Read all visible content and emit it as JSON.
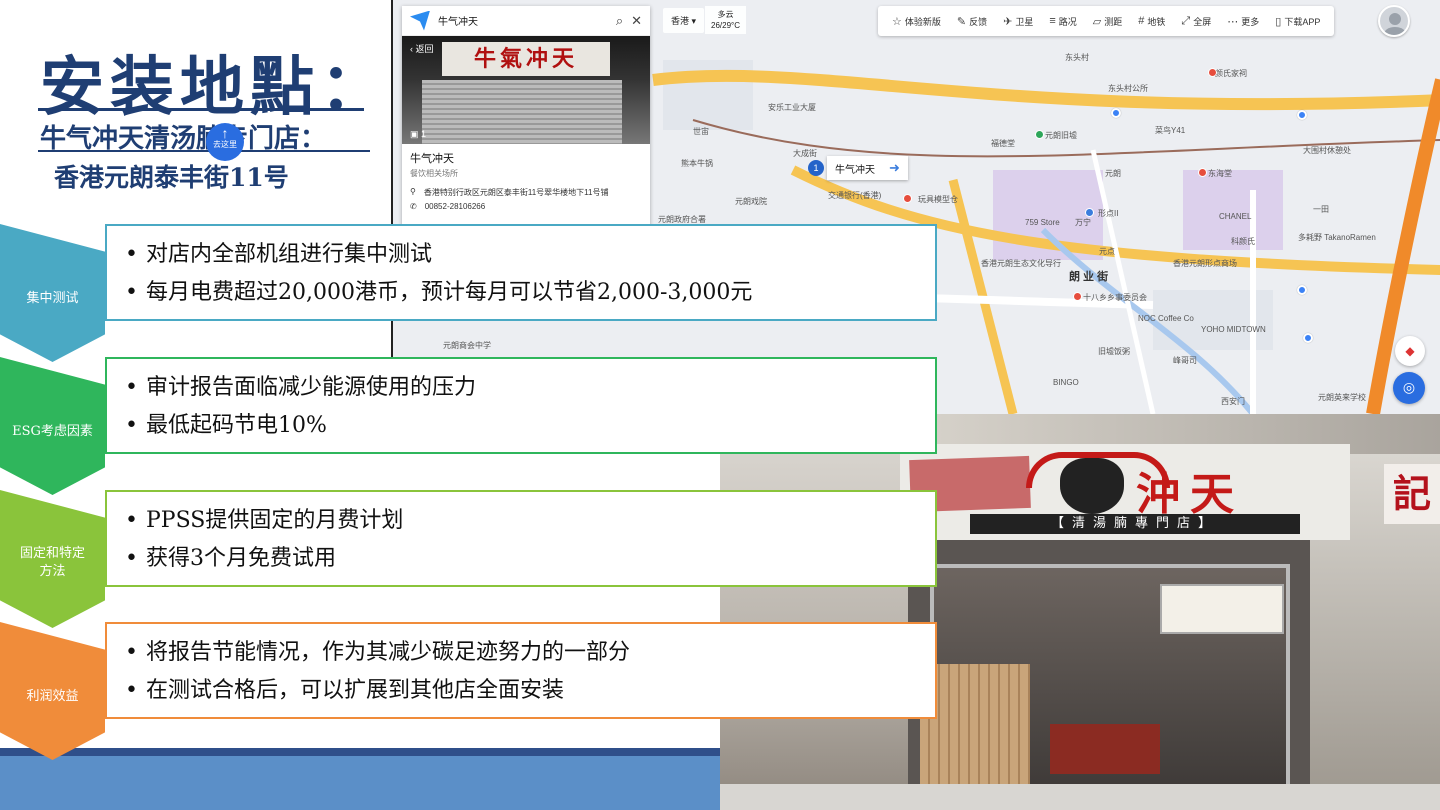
{
  "title": "安装地點：",
  "subtitle": "牛气冲天清汤腩专门店：",
  "address": "香港元朗泰丰街11号",
  "colors": {
    "title": "#1f3e73",
    "teal": "#4aa9c4",
    "green": "#2fb65c",
    "lime": "#8ac43b",
    "orange": "#f08c3a"
  },
  "sections": [
    {
      "label": "集中测试",
      "color": "#4aa9c4",
      "bullets": [
        "对店内全部机组进行集中测试",
        "每月电费超过20,000港币，预计每月可以节省2,000-3,000元"
      ]
    },
    {
      "label": "ESG考虑因素",
      "color": "#2fb65c",
      "bullets": [
        "审计报告面临减少能源使用的压力",
        "最低起码节电10%"
      ]
    },
    {
      "label_lines": [
        "固定和特定",
        "方法"
      ],
      "color": "#8ac43b",
      "bullets": [
        "PPSS提供固定的月费计划",
        "获得3个月免费试用"
      ]
    },
    {
      "label": "利润效益",
      "color": "#f08c3a",
      "bullets": [
        "将报告节能情况，作为其减少碳足迹努力的一部分",
        "在测试合格后，可以扩展到其他店全面安装"
      ]
    }
  ],
  "map": {
    "city": "香港",
    "weather_text": "多云",
    "weather_temp": "26/29°C",
    "toolbar": [
      {
        "icon": "star-icon",
        "glyph": "☆",
        "label": "体验新版"
      },
      {
        "icon": "feedback-icon",
        "glyph": "✎",
        "label": "反馈"
      },
      {
        "icon": "satellite-icon",
        "glyph": "✈",
        "label": "卫星"
      },
      {
        "icon": "traffic-icon",
        "glyph": "≡",
        "label": "路况"
      },
      {
        "icon": "ruler-icon",
        "glyph": "▱",
        "label": "测距"
      },
      {
        "icon": "subway-icon",
        "glyph": "#",
        "label": "地铁"
      },
      {
        "icon": "fullscreen-icon",
        "glyph": "⤢",
        "label": "全屏"
      },
      {
        "icon": "more-icon",
        "glyph": "⋯",
        "label": "更多"
      },
      {
        "icon": "phone-icon",
        "glyph": "▯",
        "label": "下载APP"
      }
    ],
    "search_value": "牛气冲天",
    "panel_back": "返回",
    "photo_count": "1",
    "photo_sign": "牛氣冲天",
    "goto_label": "去这里",
    "place_name": "牛气冲天",
    "place_category": "餐饮相关场所",
    "place_address": "香港特别行政区元朗区泰丰街11号翠华楼地下11号铺",
    "place_phone": "00852-28106266",
    "callout": "牛气冲天",
    "pin_number": "1",
    "road_label": "朗 业 街",
    "labels": [
      {
        "text": "东头村"
      },
      {
        "text": "东头村公所"
      },
      {
        "text": "元朗旧墟"
      },
      {
        "text": "福德堂"
      },
      {
        "text": "东海堂"
      },
      {
        "text": "大围村休憩处"
      },
      {
        "text": "元朗"
      },
      {
        "text": "形点II"
      },
      {
        "text": "CHANEL"
      },
      {
        "text": "万宁"
      },
      {
        "text": "元点"
      },
      {
        "text": "香港元朗形点商场"
      },
      {
        "text": "十八乡乡事委员会"
      },
      {
        "text": "旧墟饭粥"
      },
      {
        "text": "峰哥司"
      },
      {
        "text": "BINGO"
      },
      {
        "text": "交通银行(香港)"
      },
      {
        "text": "玩具模型仓"
      },
      {
        "text": "熊本牛锅"
      },
      {
        "text": "元朗戏院"
      },
      {
        "text": "元朗政府合署"
      },
      {
        "text": "大成街"
      },
      {
        "text": "安乐工业大厦"
      },
      {
        "text": "世宙"
      },
      {
        "text": "元朗商会中学"
      },
      {
        "text": "多耗野 TakanoRamen"
      },
      {
        "text": "一田"
      },
      {
        "text": "菜鸟Y41"
      },
      {
        "text": "颜氏家祠"
      },
      {
        "text": "元朗英来学校"
      },
      {
        "text": "西安门"
      },
      {
        "text": "NOC Coffee Co"
      },
      {
        "text": "YOHO MIDTOWN"
      },
      {
        "text": "759 Store"
      },
      {
        "text": "科颜氏"
      },
      {
        "text": "香港元朗生态文化导行"
      }
    ]
  },
  "store": {
    "brand": "沖天",
    "strip": "【清湯腩專門店】",
    "right_sign": "記"
  }
}
